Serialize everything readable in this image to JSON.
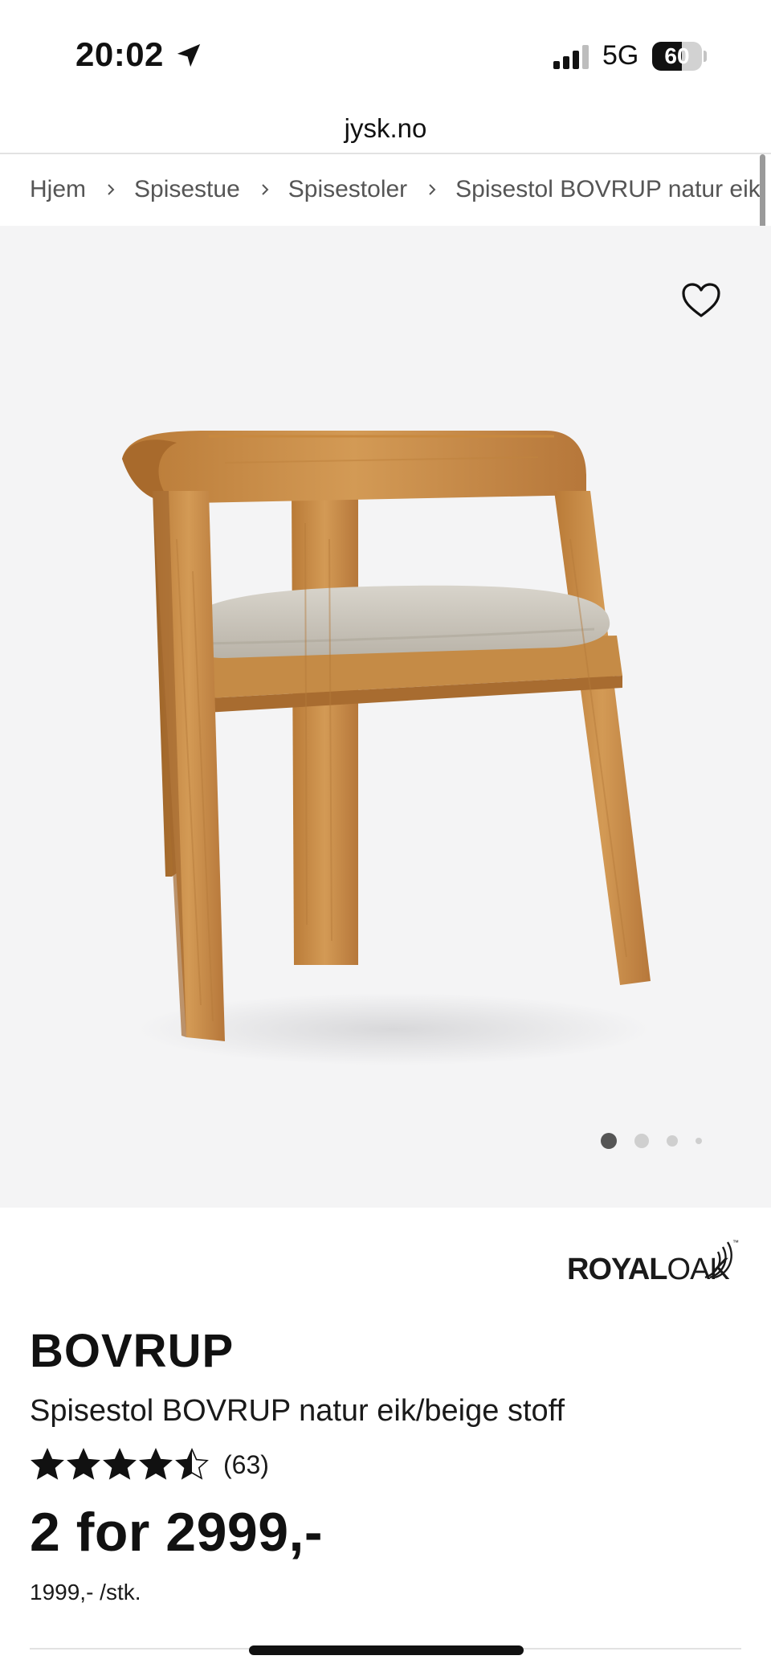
{
  "status_bar": {
    "time": "20:02",
    "network": "5G",
    "battery_level": "60",
    "battery_fraction": 0.6
  },
  "browser": {
    "url": "jysk.no"
  },
  "breadcrumb": {
    "items": [
      "Hjem",
      "Spisestue",
      "Spisestoler",
      "Spisestol BOVRUP natur eik"
    ]
  },
  "gallery": {
    "image_count": 4,
    "active_index": 0,
    "favorite_icon": "heart-icon"
  },
  "brand": {
    "name_bold": "ROYAL",
    "name_light": "OAK",
    "trademark": "™"
  },
  "product": {
    "name": "BOVRUP",
    "description": "Spisestol BOVRUP natur eik/beige stoff",
    "rating": 4.5,
    "rating_max": 5,
    "review_count": "(63)",
    "price": "2 for 2999,-",
    "unit_price": "1999,- /stk."
  },
  "colors": {
    "text": "#111111",
    "muted": "#555555",
    "gallery_bg": "#f4f4f5",
    "wood": "#c98f4a",
    "fabric": "#cbc6bc"
  }
}
